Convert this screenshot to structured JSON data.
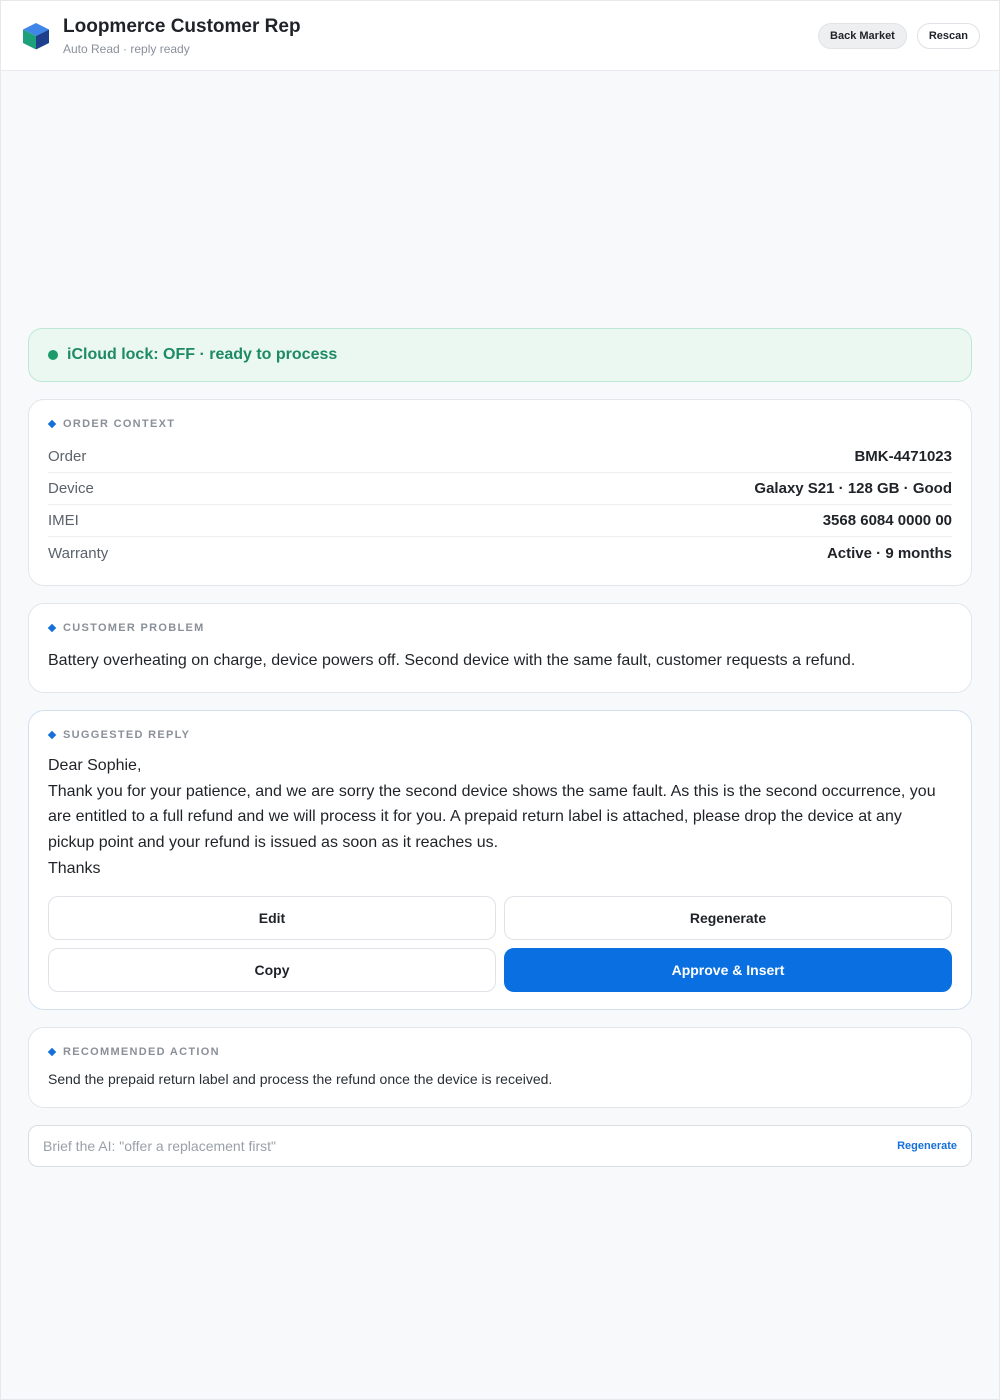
{
  "header": {
    "title": "Loopmerce Customer Rep",
    "subtitle": "Auto Read · reply ready",
    "buttons": {
      "back_market": "Back Market",
      "rescan": "Rescan"
    }
  },
  "status": {
    "text": "iCloud lock: OFF · ready to process",
    "color": "#1e9a6a"
  },
  "order_context": {
    "title": "ORDER CONTEXT",
    "rows": [
      {
        "label": "Order",
        "value": "BMK-4471023"
      },
      {
        "label": "Device",
        "value": "Galaxy S21 · 128 GB · Good"
      },
      {
        "label": "IMEI",
        "value": "3568 6084 0000 00"
      },
      {
        "label": "Warranty",
        "value": "Active · 9 months"
      }
    ]
  },
  "customer_problem": {
    "title": "CUSTOMER PROBLEM",
    "text": "Battery overheating on charge, device powers off. Second device with the same fault, customer requests a refund."
  },
  "suggested_reply": {
    "title": "SUGGESTED REPLY",
    "greeting": "Dear Sophie,",
    "body": "Thank you for your patience, and we are sorry the second device shows the same fault. As this is the second occurrence, you are entitled to a full refund and we will process it for you. A prepaid return label is attached, please drop the device at any pickup point and your refund is issued as soon as it reaches us.",
    "signoff": "Thanks",
    "buttons": {
      "edit": "Edit",
      "regenerate": "Regenerate",
      "copy": "Copy",
      "approve": "Approve & Insert"
    }
  },
  "recommended_action": {
    "title": "RECOMMENDED ACTION",
    "text": "Send the prepaid return label and process the refund once the device is received."
  },
  "brief": {
    "placeholder": "Brief the AI: \"offer a replacement first\"",
    "value": "",
    "button": "Regenerate"
  },
  "colors": {
    "accent": "#0a6fe0",
    "status_green": "#1e9a6a"
  },
  "icons": {
    "logo": "cube-logo-icon",
    "section": "diamond-icon",
    "status": "status-dot-icon"
  }
}
